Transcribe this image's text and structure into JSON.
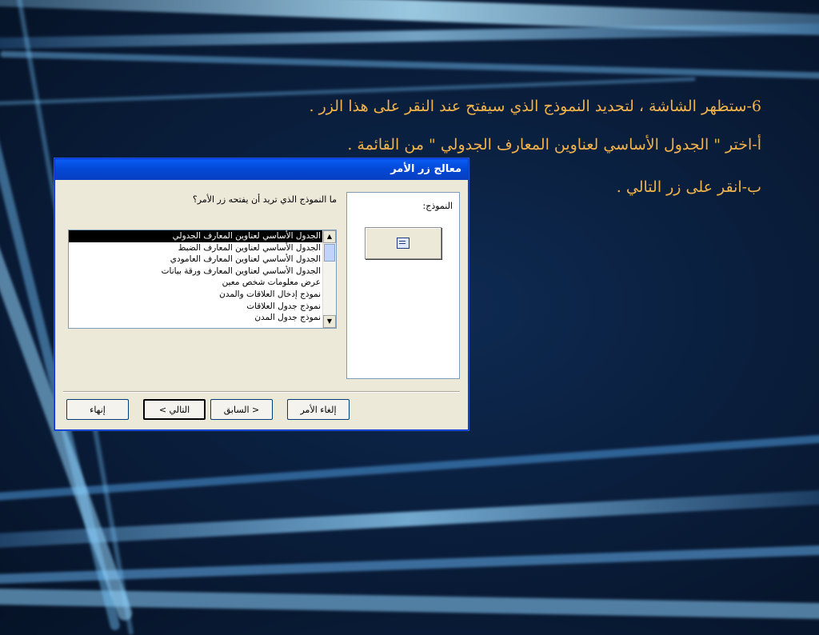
{
  "slide": {
    "line1": "6-ستظهر الشاشة ، لتحديد النموذج الذي سيفتح عند النقر على هذا الزر .",
    "line2": "أ-اختر \" الجدول الأساسي لعناوين المعارف الجدولي \" من القائمة .",
    "line3": "ب-انقر على زر التالي ."
  },
  "dialog": {
    "title": "معالج زر الأمر",
    "preview_label": "النموذج:",
    "question": "ما النموذج الذي تريد أن يفتحه زر الأمر؟",
    "list": [
      "الجدول الأساسي لعناوين المعارف الجدولي",
      "الجدول الأساسي لعناوين المعارف الضبط",
      "الجدول الأساسي لعناوين المعارف العامودي",
      "الجدول الأساسي لعناوين المعارف ورقة بيانات",
      "عرض  معلومات شخص معين",
      "نموذج إدخال العلاقات والمدن",
      "نموذج جدول العلاقات",
      "نموذج جدول المدن"
    ],
    "buttons": {
      "cancel": "إلغاء الأمر",
      "back": "< السابق",
      "next": "التالي >",
      "finish": "إنهاء"
    }
  },
  "colors": {
    "slide_text": "#f2b24a",
    "titlebar": "#0a5cf5",
    "dialog_bg": "#ece9d8"
  }
}
